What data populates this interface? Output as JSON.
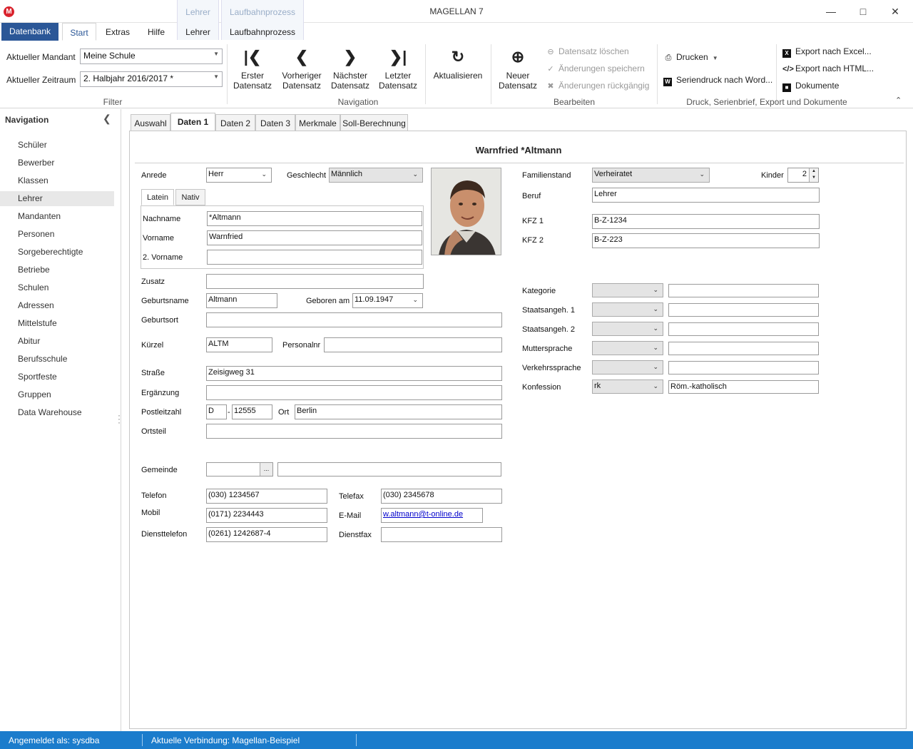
{
  "window": {
    "title": "MAGELLAN 7",
    "app_icon": "M"
  },
  "context_tabs": [
    {
      "caption": "Lehrer",
      "tab": "Lehrer"
    },
    {
      "caption": "Laufbahnprozess",
      "tab": "Laufbahnprozess"
    }
  ],
  "ribbon_tabs": {
    "file": "Datenbank",
    "start": "Start",
    "extras": "Extras",
    "hilfe": "Hilfe"
  },
  "filter": {
    "mandant_label": "Aktueller Mandant",
    "mandant_value": "Meine Schule",
    "zeitraum_label": "Aktueller Zeitraum",
    "zeitraum_value": "2. Halbjahr 2016/2017 *",
    "group_label": "Filter"
  },
  "navigation_group": {
    "first": [
      "Erster",
      "Datensatz"
    ],
    "prev": [
      "Vorheriger",
      "Datensatz"
    ],
    "next": [
      "Nächster",
      "Datensatz"
    ],
    "last": [
      "Letzter",
      "Datensatz"
    ],
    "group_label": "Navigation"
  },
  "refresh": {
    "label": "Aktualisieren"
  },
  "bearbeiten": {
    "new": [
      "Neuer",
      "Datensatz"
    ],
    "delete": "Datensatz löschen",
    "save": "Änderungen speichern",
    "undo": "Änderungen rückgängig",
    "group_label": "Bearbeiten"
  },
  "druck": {
    "print": "Drucken",
    "word": "Seriendruck nach Word...",
    "excel": "Export nach Excel...",
    "html": "Export nach HTML...",
    "docs": "Dokumente",
    "group_label": "Druck, Serienbrief, Export und Dokumente"
  },
  "nav": {
    "title": "Navigation",
    "items": [
      "Schüler",
      "Bewerber",
      "Klassen",
      "Lehrer",
      "Mandanten",
      "Personen",
      "Sorgeberechtigte",
      "Betriebe",
      "Schulen",
      "Adressen",
      "Mittelstufe",
      "Abitur",
      "Berufsschule",
      "Sportfeste",
      "Gruppen",
      "Data Warehouse"
    ],
    "selected": "Lehrer"
  },
  "content_tabs": [
    "Auswahl",
    "Daten 1",
    "Daten 2",
    "Daten 3",
    "Merkmale",
    "Soll-Berechnung"
  ],
  "person": {
    "title": "Warnfried *Altmann"
  },
  "form": {
    "anrede_label": "Anrede",
    "anrede": "Herr",
    "geschlecht_label": "Geschlecht",
    "geschlecht": "Männlich",
    "subtabs": [
      "Latein",
      "Nativ"
    ],
    "nachname_label": "Nachname",
    "nachname": "*Altmann",
    "vorname_label": "Vorname",
    "vorname": "Warnfried",
    "vorname2_label": "2. Vorname",
    "vorname2": "",
    "zusatz_label": "Zusatz",
    "zusatz": "",
    "geburtsname_label": "Geburtsname",
    "geburtsname": "Altmann",
    "geboren_label": "Geboren am",
    "geboren": "11.09.1947",
    "geburtsort_label": "Geburtsort",
    "geburtsort": "",
    "kuerzel_label": "Kürzel",
    "kuerzel": "ALTM",
    "personalnr_label": "Personalnr",
    "personalnr": "",
    "strasse_label": "Straße",
    "strasse": "Zeisigweg 31",
    "ergaenzung_label": "Ergänzung",
    "ergaenzung": "",
    "plz_label": "Postleitzahl",
    "land": "D",
    "plz_sep": "-",
    "plz": "12555",
    "ort_label": "Ort",
    "ort": "Berlin",
    "ortsteil_label": "Ortsteil",
    "ortsteil": "",
    "gemeinde_label": "Gemeinde",
    "gemeinde_btn": "...",
    "telefon_label": "Telefon",
    "telefon": "(030) 1234567",
    "telefax_label": "Telefax",
    "telefax": "(030) 2345678",
    "mobil_label": "Mobil",
    "mobil": "(0171) 2234443",
    "email_label": "E-Mail",
    "email": "w.altmann@t-online.de",
    "diensttelefon_label": "Diensttelefon",
    "diensttelefon": "(0261) 1242687-4",
    "dienstfax_label": "Dienstfax",
    "dienstfax": ""
  },
  "right": {
    "familienstand_label": "Familienstand",
    "familienstand": "Verheiratet",
    "kinder_label": "Kinder",
    "kinder": "2",
    "beruf_label": "Beruf",
    "beruf": "Lehrer",
    "kfz1_label": "KFZ 1",
    "kfz1": "B-Z-1234",
    "kfz2_label": "KFZ 2",
    "kfz2": "B-Z-223",
    "kategorie_label": "Kategorie",
    "staat1_label": "Staatsangeh. 1",
    "staat2_label": "Staatsangeh. 2",
    "mutter_label": "Muttersprache",
    "verkehr_label": "Verkehrssprache",
    "konfession_label": "Konfession",
    "konfession_code": "rk",
    "konfession_text": "Röm.-katholisch"
  },
  "status": {
    "user": "Angemeldet als: sysdba",
    "connection": "Aktuelle Verbindung: Magellan-Beispiel"
  },
  "colors": {
    "accent": "#2b5797",
    "status_bar": "#1b7ccc",
    "brand_icon": "#d9232d"
  }
}
